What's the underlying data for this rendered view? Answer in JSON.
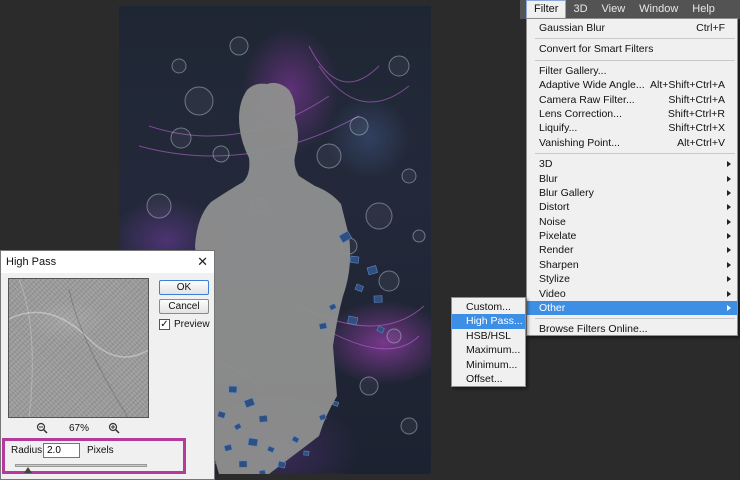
{
  "menubar": {
    "items": [
      {
        "label": "Filter",
        "active": true
      },
      {
        "label": "3D"
      },
      {
        "label": "View"
      },
      {
        "label": "Window"
      },
      {
        "label": "Help"
      }
    ]
  },
  "filter_menu": {
    "last_filter": {
      "label": "Gaussian Blur",
      "shortcut": "Ctrl+F"
    },
    "convert": {
      "label": "Convert for Smart Filters"
    },
    "gallery_group": [
      {
        "label": "Filter Gallery...",
        "shortcut": ""
      },
      {
        "label": "Adaptive Wide Angle...",
        "shortcut": "Alt+Shift+Ctrl+A"
      },
      {
        "label": "Camera Raw Filter...",
        "shortcut": "Shift+Ctrl+A"
      },
      {
        "label": "Lens Correction...",
        "shortcut": "Shift+Ctrl+R"
      },
      {
        "label": "Liquify...",
        "shortcut": "Shift+Ctrl+X"
      },
      {
        "label": "Vanishing Point...",
        "shortcut": "Alt+Ctrl+V"
      }
    ],
    "categories": [
      {
        "label": "3D"
      },
      {
        "label": "Blur"
      },
      {
        "label": "Blur Gallery"
      },
      {
        "label": "Distort"
      },
      {
        "label": "Noise"
      },
      {
        "label": "Pixelate"
      },
      {
        "label": "Render"
      },
      {
        "label": "Sharpen"
      },
      {
        "label": "Stylize"
      },
      {
        "label": "Video"
      },
      {
        "label": "Other",
        "highlighted": true
      }
    ],
    "browse": {
      "label": "Browse Filters Online..."
    }
  },
  "other_submenu": {
    "items": [
      {
        "label": "Custom..."
      },
      {
        "label": "High Pass...",
        "highlighted": true
      },
      {
        "label": "HSB/HSL"
      },
      {
        "label": "Maximum..."
      },
      {
        "label": "Minimum..."
      },
      {
        "label": "Offset..."
      }
    ]
  },
  "dialog": {
    "title": "High Pass",
    "close_glyph": "✕",
    "ok_label": "OK",
    "cancel_label": "Cancel",
    "preview_label": "Preview",
    "preview_checked": true,
    "zoom_level": "67%",
    "radius_label": "Radius:",
    "radius_value": "2.0",
    "radius_unit": "Pixels",
    "radius_slider_fraction": 0.1,
    "highlight_color": "#b43a9b"
  },
  "colors": {
    "menu_highlight": "#3d8ee5",
    "menubar_bg": "#535353",
    "workspace_bg": "#2b2b2b"
  }
}
